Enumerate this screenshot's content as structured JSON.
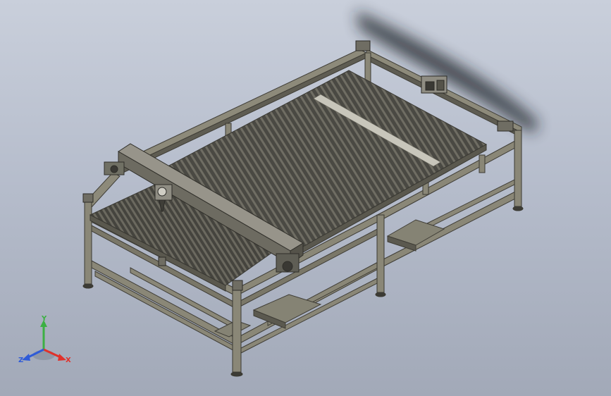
{
  "triad": {
    "x_label": "X",
    "y_label": "Y",
    "z_label": "Z",
    "x_color": "#e0322b",
    "y_color": "#3cb043",
    "z_color": "#2f5bd8"
  },
  "colors": {
    "background_top": "#c9cfdb",
    "background_bottom": "#a2a9b8",
    "frame": "#7d7a6b",
    "frame_dark": "#4b4940",
    "bed_dark": "#3f3e38",
    "slat": "#6c6a60",
    "shadow": "#1f2226"
  }
}
